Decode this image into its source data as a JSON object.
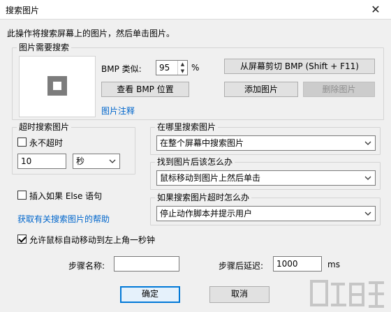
{
  "window": {
    "title": "搜索图片",
    "close_label": "✕"
  },
  "instruction": "此操作将搜索屏幕上的图片，然后单击图片。",
  "search_group": {
    "title": "图片需要搜索",
    "bmp_similar_label": "BMP 类似:",
    "bmp_similar_value": "95",
    "percent_sign": "%",
    "capture_button": "从屏幕剪切 BMP (Shift + F11)",
    "view_bmp_button": "查看 BMP 位置",
    "add_image_button": "添加图片",
    "delete_image_button": "删除图片",
    "annotation_link": "图片注释"
  },
  "timeout_group": {
    "title": "超时搜索图片",
    "never_timeout_label": "永不超时",
    "never_timeout_checked": false,
    "timeout_value": "10",
    "unit_selected": "秒"
  },
  "where_group": {
    "title": "在哪里搜索图片",
    "selected": "在整个屏幕中搜索图片"
  },
  "found_group": {
    "title": "找到图片后该怎么办",
    "selected": "鼠标移动到图片上然后单击"
  },
  "timeout_action_group": {
    "title": "如果搜索图片超时怎么办",
    "selected": "停止动作脚本并提示用户"
  },
  "insert_else": {
    "label": "插入如果 Else 语句",
    "checked": false
  },
  "help_link": "获取有关搜索图片的帮助",
  "allow_mouse": {
    "label": "允许鼠标自动移动到左上角一秒钟",
    "checked": true
  },
  "step_name": {
    "label": "步骤名称:",
    "value": ""
  },
  "step_delay": {
    "label": "步骤后延迟:",
    "value": "1000",
    "unit": "ms"
  },
  "buttons": {
    "ok": "确定",
    "cancel": "取消"
  }
}
